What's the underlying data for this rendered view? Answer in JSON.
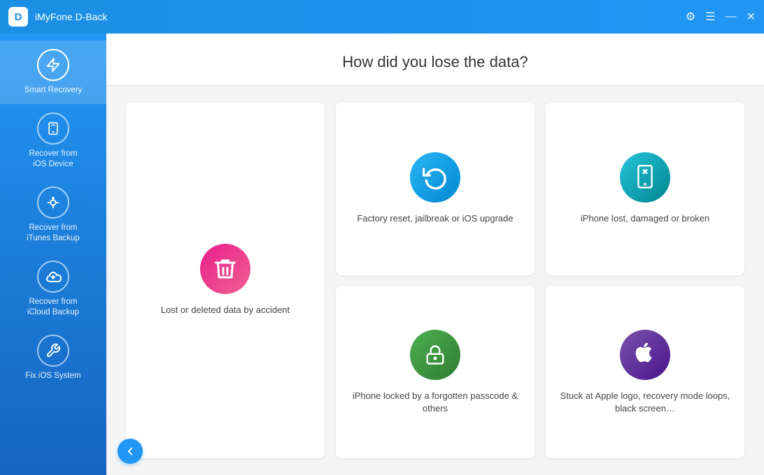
{
  "titleBar": {
    "logoText": "D",
    "appName": "iMyFone D-Back",
    "gearIcon": "⚙",
    "menuIcon": "☰",
    "minimizeIcon": "—",
    "closeIcon": "✕"
  },
  "sidebar": {
    "items": [
      {
        "id": "smart-recovery",
        "label": "Smart Recovery",
        "icon": "⚡",
        "active": true
      },
      {
        "id": "recover-ios",
        "label": "Recover from\niOS Device",
        "icon": "📱",
        "active": false
      },
      {
        "id": "recover-itunes",
        "label": "Recover from\niTunes Backup",
        "icon": "🎵",
        "active": false
      },
      {
        "id": "recover-icloud",
        "label": "Recover from\niCloud Backup",
        "icon": "☁",
        "active": false
      },
      {
        "id": "fix-ios",
        "label": "Fix iOS System",
        "icon": "🔧",
        "active": false
      }
    ]
  },
  "content": {
    "heading": "How did you lose the data?",
    "cards": [
      {
        "id": "lost-deleted",
        "label": "Lost or deleted data by accident",
        "iconBg": "#e91e8c",
        "iconSymbol": "🗑",
        "large": true
      },
      {
        "id": "factory-reset",
        "label": "Factory reset, jailbreak or iOS upgrade",
        "iconBg": "#29b6f6",
        "iconSymbol": "↺",
        "large": false
      },
      {
        "id": "iphone-lost",
        "label": "iPhone lost, damaged or broken",
        "iconBg": "#26c6da",
        "iconSymbol": "📱",
        "large": false
      },
      {
        "id": "iphone-locked",
        "label": "iPhone locked by a forgotten passcode & others",
        "iconBg": "#4caf50",
        "iconSymbol": "🔒",
        "large": false
      },
      {
        "id": "stuck-apple",
        "label": "Stuck at Apple logo, recovery mode loops, black screen…",
        "iconBg": "#7b52ab",
        "iconSymbol": "",
        "large": false
      }
    ],
    "backButtonIcon": "←"
  }
}
